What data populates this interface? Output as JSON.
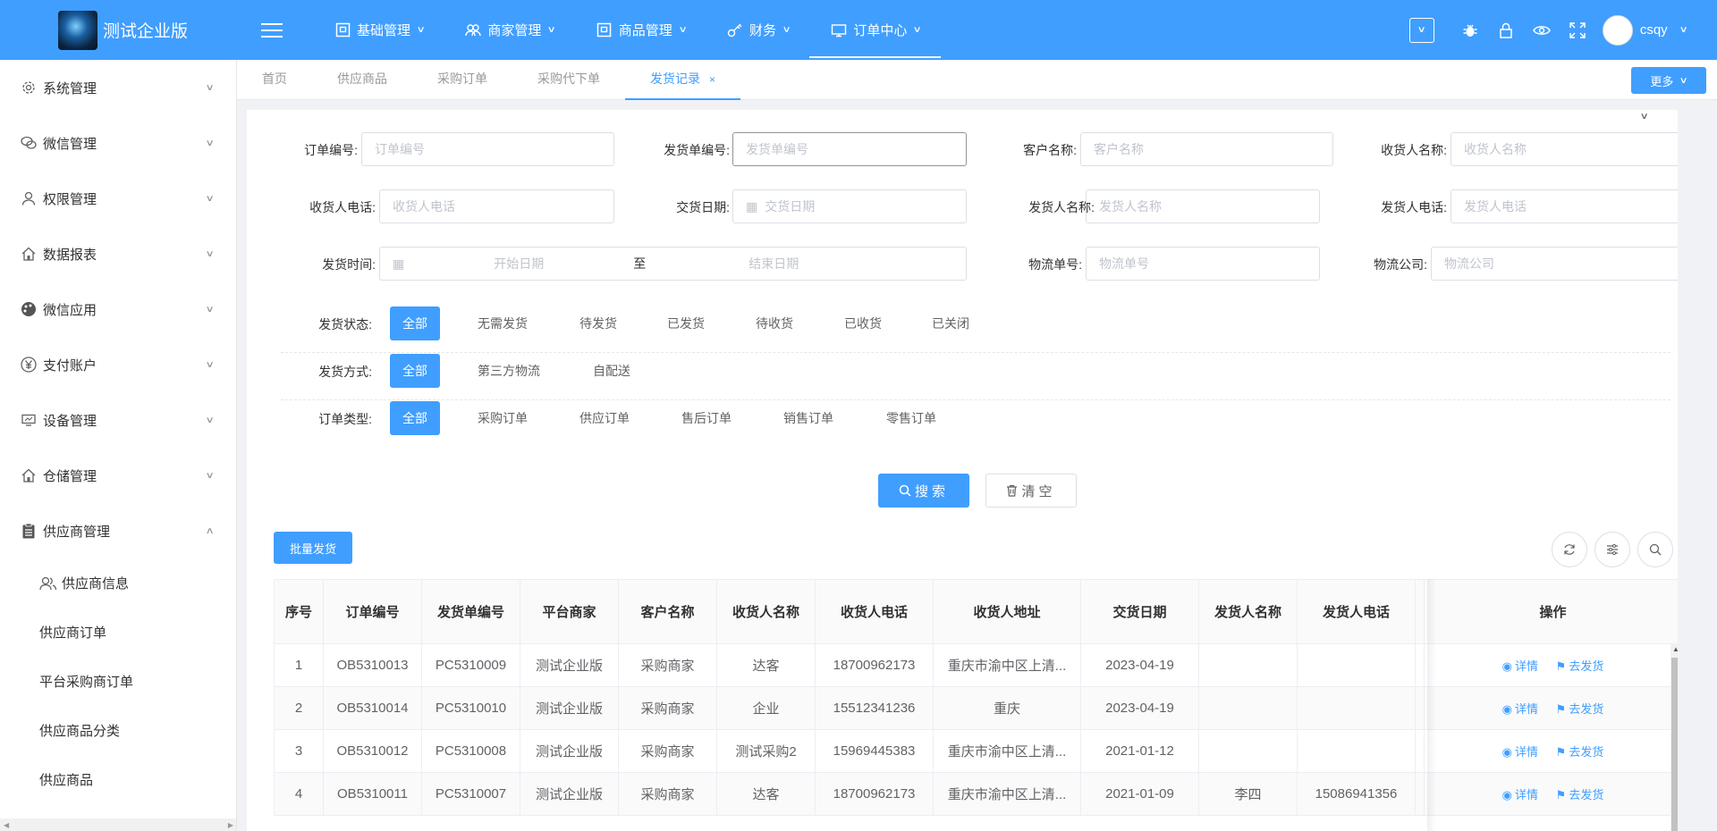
{
  "app": {
    "title": "测试企业版",
    "username": "csqy"
  },
  "nav": [
    {
      "label": "基础管理",
      "icon": "monitor-icon"
    },
    {
      "label": "商家管理",
      "icon": "users-icon"
    },
    {
      "label": "商品管理",
      "icon": "box-icon"
    },
    {
      "label": "财务",
      "icon": "key-icon"
    },
    {
      "label": "订单中心",
      "icon": "screen-icon"
    }
  ],
  "sidebar": {
    "items": [
      {
        "label": "系统管理"
      },
      {
        "label": "微信管理"
      },
      {
        "label": "权限管理"
      },
      {
        "label": "数据报表"
      },
      {
        "label": "微信应用"
      },
      {
        "label": "支付账户"
      },
      {
        "label": "设备管理"
      },
      {
        "label": "仓储管理"
      },
      {
        "label": "供应商管理"
      }
    ],
    "sub": [
      {
        "label": "供应商信息"
      },
      {
        "label": "供应商订单"
      },
      {
        "label": "平台采购商订单"
      },
      {
        "label": "供应商品分类"
      },
      {
        "label": "供应商品"
      }
    ]
  },
  "tabs": [
    {
      "label": "首页"
    },
    {
      "label": "供应商品"
    },
    {
      "label": "采购订单"
    },
    {
      "label": "采购代下单"
    },
    {
      "label": "发货记录",
      "close": "×"
    }
  ],
  "more_label": "更多",
  "filters": {
    "order_no": {
      "label": "订单编号:",
      "placeholder": "订单编号"
    },
    "ship_no": {
      "label": "发货单编号:",
      "placeholder": "发货单编号"
    },
    "customer": {
      "label": "客户名称:",
      "placeholder": "客户名称"
    },
    "receiver": {
      "label": "收货人名称:",
      "placeholder": "收货人名称"
    },
    "receiver_phone": {
      "label": "收货人电话:",
      "placeholder": "收货人电话"
    },
    "deliver_date": {
      "label": "交货日期:",
      "placeholder": "交货日期"
    },
    "shipper": {
      "label": "发货人名称:",
      "placeholder": "发货人名称"
    },
    "shipper_phone": {
      "label": "发货人电话:",
      "placeholder": "发货人电话"
    },
    "ship_time": {
      "label": "发货时间:",
      "start": "开始日期",
      "sep": "至",
      "end": "结束日期"
    },
    "logistics_no": {
      "label": "物流单号:",
      "placeholder": "物流单号"
    },
    "logistics_co": {
      "label": "物流公司:",
      "placeholder": "物流公司"
    }
  },
  "status": {
    "label": "发货状态:",
    "options": [
      "全部",
      "无需发货",
      "待发货",
      "已发货",
      "待收货",
      "已收货",
      "已关闭"
    ]
  },
  "method": {
    "label": "发货方式:",
    "options": [
      "全部",
      "第三方物流",
      "自配送"
    ]
  },
  "otype": {
    "label": "订单类型:",
    "options": [
      "全部",
      "采购订单",
      "供应订单",
      "售后订单",
      "销售订单",
      "零售订单"
    ]
  },
  "buttons": {
    "search": "搜索",
    "clear": "清空",
    "batch": "批量发货"
  },
  "table": {
    "headers": [
      "序号",
      "订单编号",
      "发货单编号",
      "平台商家",
      "客户名称",
      "收货人名称",
      "收货人电话",
      "收货人地址",
      "交货日期",
      "发货人名称",
      "发货人电话",
      "",
      "操作"
    ],
    "detail": "详情",
    "ship": "去发货",
    "rows": [
      [
        "1",
        "OB5310013",
        "PC5310009",
        "测试企业版",
        "采购商家",
        "达客",
        "18700962173",
        "重庆市渝中区上清...",
        "2023-04-19",
        "",
        ""
      ],
      [
        "2",
        "OB5310014",
        "PC5310010",
        "测试企业版",
        "采购商家",
        "企业",
        "15512341236",
        "重庆",
        "2023-04-19",
        "",
        ""
      ],
      [
        "3",
        "OB5310012",
        "PC5310008",
        "测试企业版",
        "采购商家",
        "测试采购2",
        "15969445383",
        "重庆市渝中区上清...",
        "2021-01-12",
        "",
        ""
      ],
      [
        "4",
        "OB5310011",
        "PC5310007",
        "测试企业版",
        "采购商家",
        "达客",
        "18700962173",
        "重庆市渝中区上清...",
        "2021-01-09",
        "李四",
        "15086941356"
      ]
    ]
  },
  "colors": {
    "primary": "#409eff"
  }
}
